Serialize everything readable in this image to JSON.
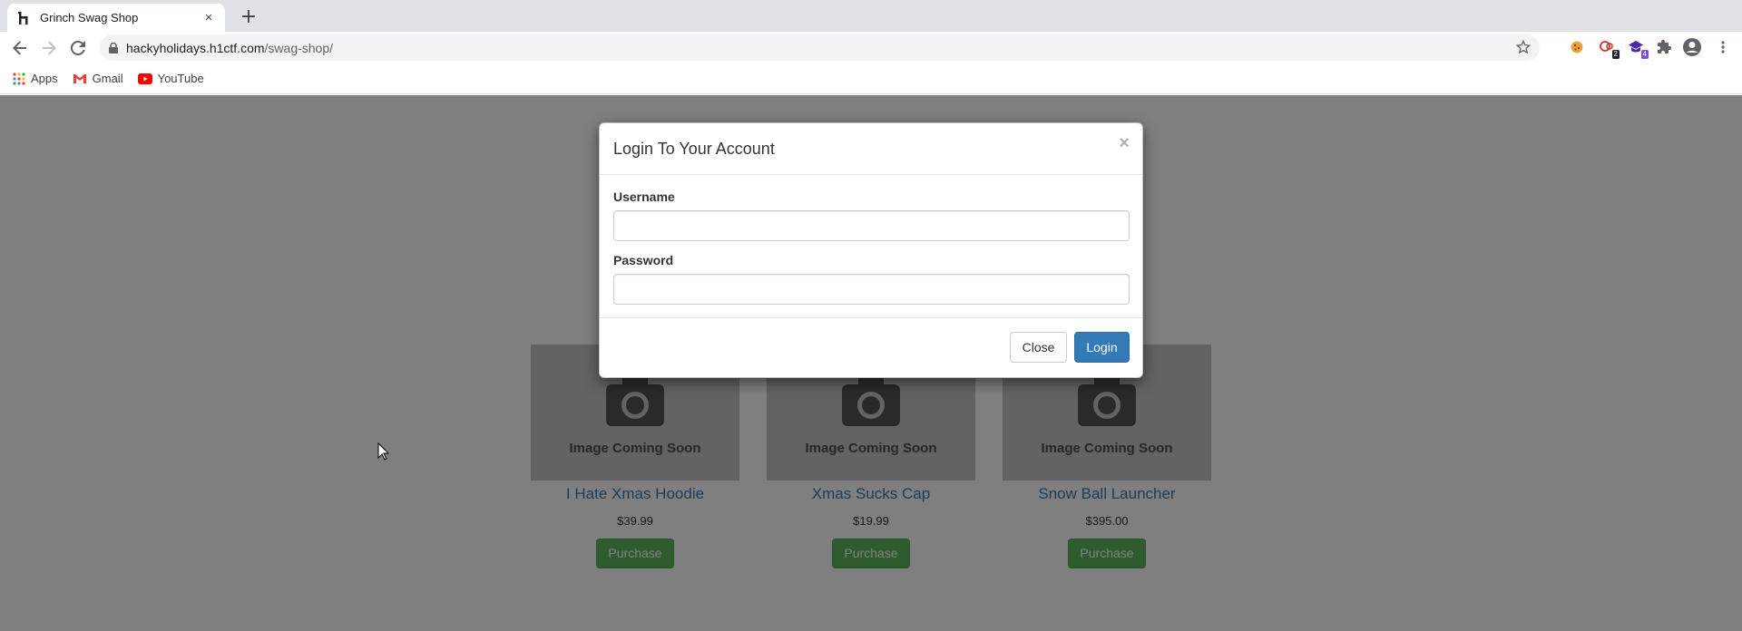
{
  "browser": {
    "tab_title": "Grinch Swag Shop",
    "url_host": "hackyholidays.h1ctf.com",
    "url_path": "/swag-shop/",
    "new_tab_symbol": "+",
    "tab_close_symbol": "×",
    "extension_badges": [
      "2",
      "4"
    ],
    "bookmarks": [
      {
        "label": "Apps",
        "icon": "apps-grid-icon"
      },
      {
        "label": "Gmail",
        "icon": "gmail-icon"
      },
      {
        "label": "YouTube",
        "icon": "youtube-icon"
      }
    ]
  },
  "products": [
    {
      "image_text": "Image Coming Soon",
      "name": "I Hate Xmas Hoodie",
      "price": "$39.99",
      "button": "Purchase"
    },
    {
      "image_text": "Image Coming Soon",
      "name": "Xmas Sucks Cap",
      "price": "$19.99",
      "button": "Purchase"
    },
    {
      "image_text": "Image Coming Soon",
      "name": "Snow Ball Launcher",
      "price": "$395.00",
      "button": "Purchase"
    }
  ],
  "modal": {
    "title": "Login To Your Account",
    "close_x": "×",
    "username_label": "Username",
    "username_value": "",
    "password_label": "Password",
    "password_value": "",
    "close_button": "Close",
    "login_button": "Login"
  },
  "colors": {
    "primary_button": "#337ab7",
    "success_button": "#5cb85c",
    "link": "#337ab7",
    "backdrop": "#000000"
  }
}
